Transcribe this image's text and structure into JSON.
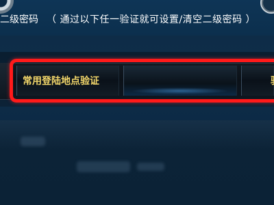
{
  "header": {
    "title": "二级密码",
    "hint": "（ 通过以下任一验证就可设置/清空二级密码 ）"
  },
  "tabs": [
    {
      "label": "常用登陆地点验证"
    },
    {
      "label": ""
    },
    {
      "label": "验"
    }
  ],
  "colors": {
    "highlight": "#ff1a1a",
    "tab_label": "#f2d66a",
    "header_text": "#ffffff",
    "background": "#0f2e4a"
  },
  "icons": [
    "settings-gear-icon",
    "close-icon"
  ]
}
